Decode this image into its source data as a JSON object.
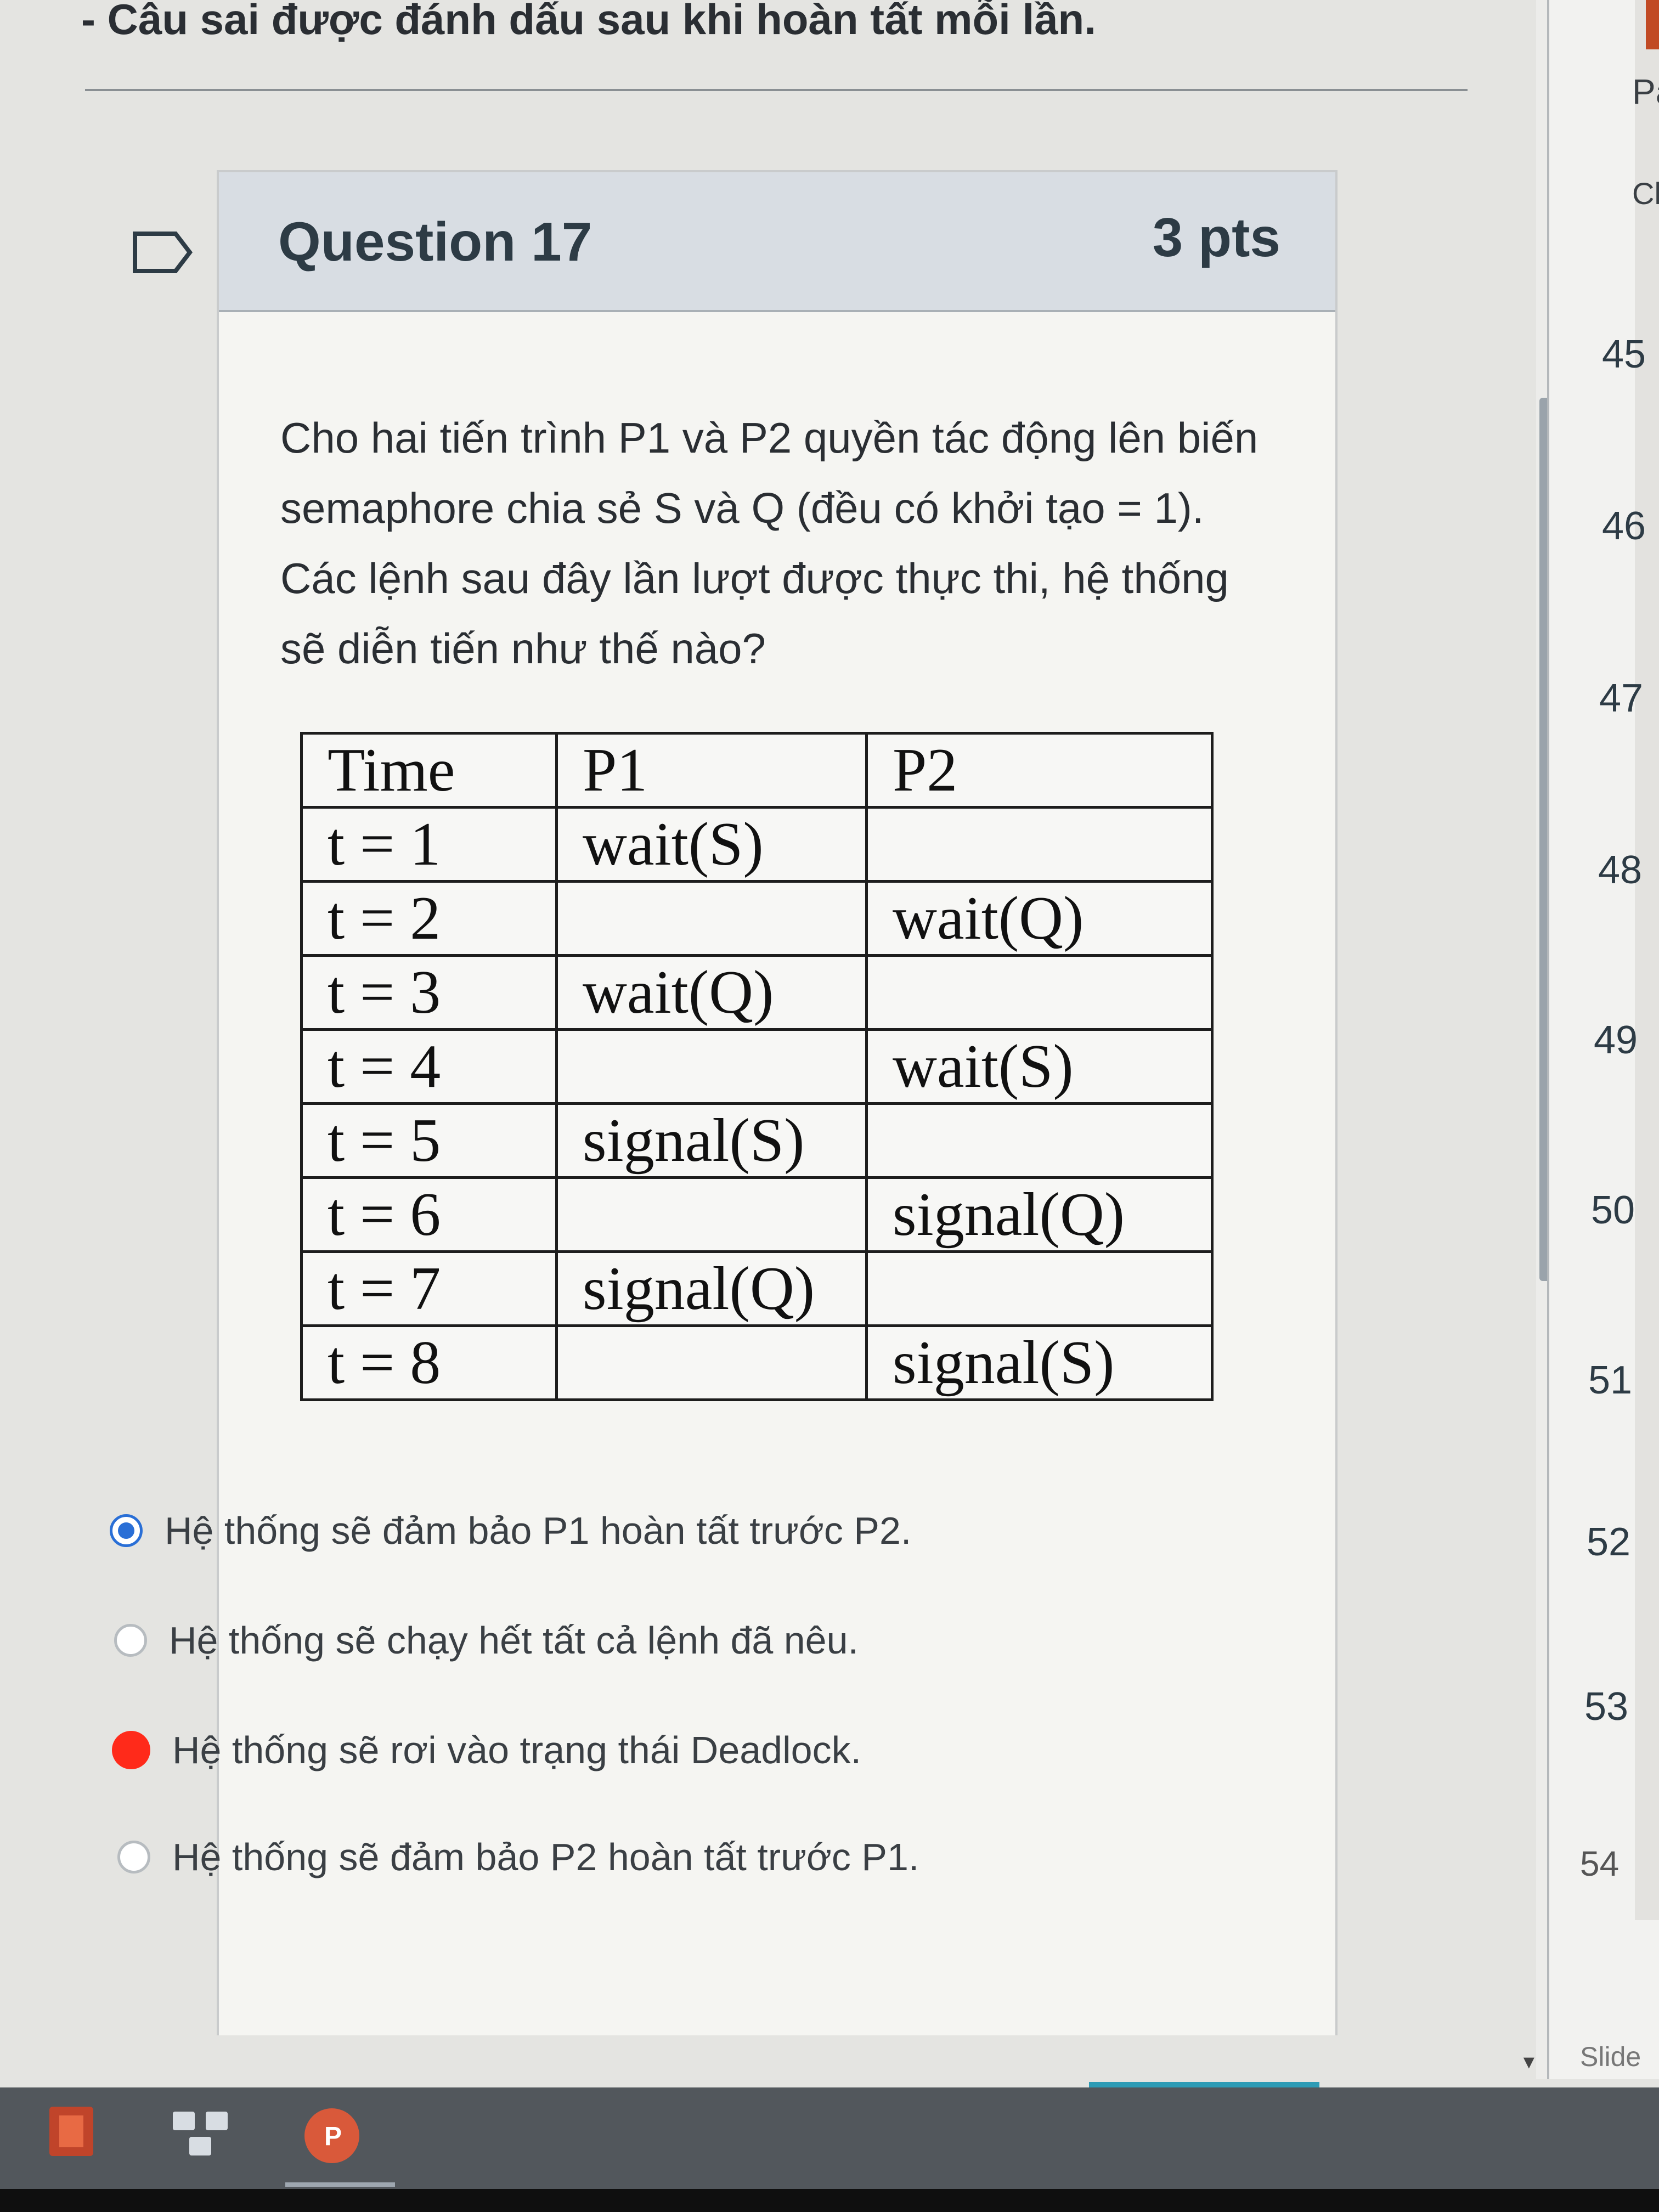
{
  "page": {
    "instruction_note": "- Câu sai được đánh dấu sau khi hoàn tất mỗi lần."
  },
  "question": {
    "title": "Question 17",
    "points": "3 pts",
    "text": "Cho hai tiến trình P1 và P2 quyền tác động lên biến semaphore chia sẻ S và Q (đều có khởi tạo = 1). Các lệnh sau đây lần lượt được thực thi, hệ thống sẽ diễn tiến như thế nào?",
    "table": {
      "headers": [
        "Time",
        "P1",
        "P2"
      ],
      "rows": [
        [
          "t = 1",
          "wait(S)",
          ""
        ],
        [
          "t = 2",
          "",
          "wait(Q)"
        ],
        [
          "t = 3",
          "wait(Q)",
          ""
        ],
        [
          "t = 4",
          "",
          "wait(S)"
        ],
        [
          "t = 5",
          "signal(S)",
          ""
        ],
        [
          "t = 6",
          "",
          "signal(Q)"
        ],
        [
          "t = 7",
          "signal(Q)",
          ""
        ],
        [
          "t = 8",
          "",
          "signal(S)"
        ]
      ]
    },
    "answers": [
      {
        "label": "Hệ thống sẽ đảm bảo P1 hoàn tất trước P2.",
        "state": "selected"
      },
      {
        "label": "Hệ thống sẽ chạy hết tất cả lệnh đã nêu.",
        "state": "unselected"
      },
      {
        "label": "Hệ thống sẽ rơi vào trạng thái Deadlock.",
        "state": "marked"
      },
      {
        "label": "Hệ thống sẽ đảm bảo P2 hoàn tất trước P1.",
        "state": "unselected"
      }
    ]
  },
  "side_panel": {
    "label_top": "Pa",
    "label_second": "Cl",
    "slide_numbers": [
      "45",
      "46",
      "47",
      "48",
      "49",
      "50",
      "51",
      "52",
      "53",
      "54"
    ],
    "slide_label": "Slide"
  },
  "colors": {
    "selected_radio": "#2a6fd6",
    "marked_dot": "#ff2a1a",
    "header_bg": "#d8dde3"
  },
  "icons": {
    "question_marker": "flag-outline-icon",
    "taskbar": [
      "office-app-icon",
      "network-app-icon",
      "powerpoint-icon"
    ]
  }
}
